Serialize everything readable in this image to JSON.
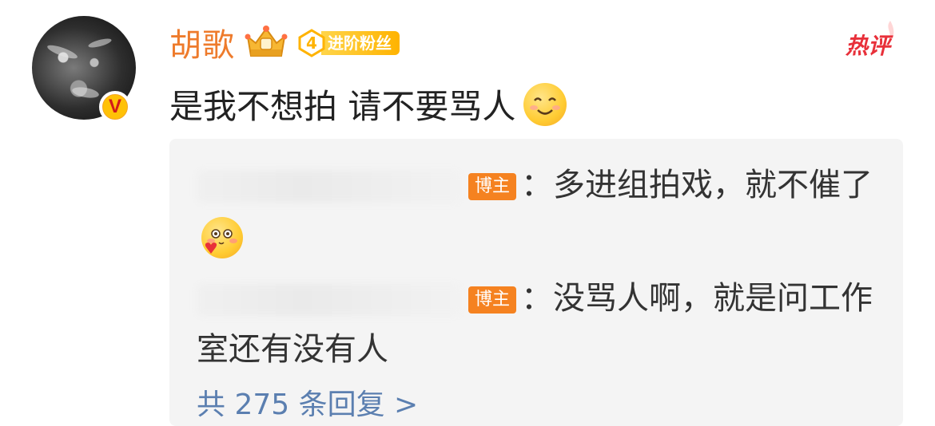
{
  "comment": {
    "username": "胡歌",
    "fan_badge": {
      "level": "4",
      "label": "进阶粉丝"
    },
    "hot_label": "热评",
    "text": "是我不想拍 请不要骂人",
    "verified_mark": "V",
    "icons": [
      "avatar",
      "verified-badge-icon",
      "crown-icon",
      "fan-level-icon",
      "smile-emoji-icon"
    ]
  },
  "replies": [
    {
      "tag": "博主",
      "text": "：多进组拍戏，就不催了",
      "emoji": "blush-heart-emoji-icon"
    },
    {
      "tag": "博主",
      "text": "：没骂人啊，就是问工作室还有没有人"
    }
  ],
  "more_replies": "共 275 条回复 >",
  "colors": {
    "username": "#ee7b2c",
    "hot": "#e8303a",
    "author_tag": "#f58220",
    "link": "#5b7fb0",
    "reply_bg": "#f4f4f4",
    "verified": "#f5a623"
  }
}
